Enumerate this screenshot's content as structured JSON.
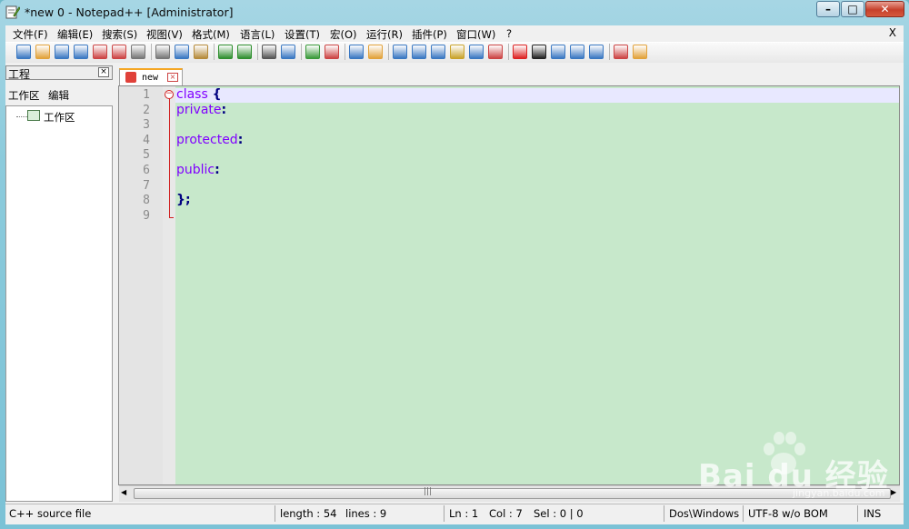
{
  "window": {
    "title": "*new  0 - Notepad++ [Administrator]",
    "minimize_glyph": "–",
    "maximize_glyph": "□",
    "close_glyph": "✕"
  },
  "menubar": {
    "items": [
      "文件(F)",
      "编辑(E)",
      "搜索(S)",
      "视图(V)",
      "格式(M)",
      "语言(L)",
      "设置(T)",
      "宏(O)",
      "运行(R)",
      "插件(P)",
      "窗口(W)",
      "?"
    ],
    "close_label": "X"
  },
  "project_panel": {
    "title": "工程",
    "close_glyph": "×",
    "menu": [
      "工作区",
      "编辑"
    ],
    "tree_root": "工作区"
  },
  "tab": {
    "label": "new",
    "close_glyph": "×"
  },
  "editor": {
    "lines": [
      {
        "num": "1",
        "code": "class",
        "op": " {"
      },
      {
        "num": "2",
        "code": "private",
        "op": ":"
      },
      {
        "num": "3",
        "code": "",
        "op": ""
      },
      {
        "num": "4",
        "code": "protected",
        "op": ":"
      },
      {
        "num": "5",
        "code": "",
        "op": ""
      },
      {
        "num": "6",
        "code": "public",
        "op": ":"
      },
      {
        "num": "7",
        "code": "",
        "op": ""
      },
      {
        "num": "8",
        "code": "",
        "op": "};"
      },
      {
        "num": "9",
        "code": "",
        "op": ""
      }
    ],
    "fold_glyph": "−",
    "colors": {
      "background": "#c7e8cb",
      "keyword": "#8000ff",
      "operator": "#000080",
      "current_line": "#e8e8ff"
    }
  },
  "scrollbar": {
    "left_glyph": "◀",
    "grip_glyph": "|||",
    "right_glyph": "▶"
  },
  "statusbar": {
    "file_type": "C++ source file",
    "length": "length : 54",
    "lines": "lines : 9",
    "ln": "Ln : 1",
    "col": "Col : 7",
    "sel": "Sel : 0 | 0",
    "eol": "Dos\\Windows",
    "encoding": "UTF-8 w/o BOM",
    "mode": "INS"
  },
  "watermark": {
    "text": "Bai du 经验",
    "url": "jingyan.baidu.com"
  },
  "toolbar": {
    "icons": [
      "new-file-icon",
      "open-file-icon",
      "save-icon",
      "save-all-icon",
      "close-icon",
      "close-all-icon",
      "print-icon",
      "cut-icon",
      "copy-icon",
      "paste-icon",
      "undo-icon",
      "redo-icon",
      "find-icon",
      "replace-icon",
      "zoom-in-icon",
      "zoom-out-icon",
      "sync-v-icon",
      "sync-h-icon",
      "word-wrap-icon",
      "all-chars-icon",
      "indent-guide-icon",
      "user-lang-icon",
      "doc-map-icon",
      "function-list-icon",
      "record-macro-icon",
      "stop-record-icon",
      "play-macro-icon",
      "run-multiple-icon",
      "save-macro-icon",
      "spell-check-icon",
      "spell-options-icon"
    ]
  }
}
